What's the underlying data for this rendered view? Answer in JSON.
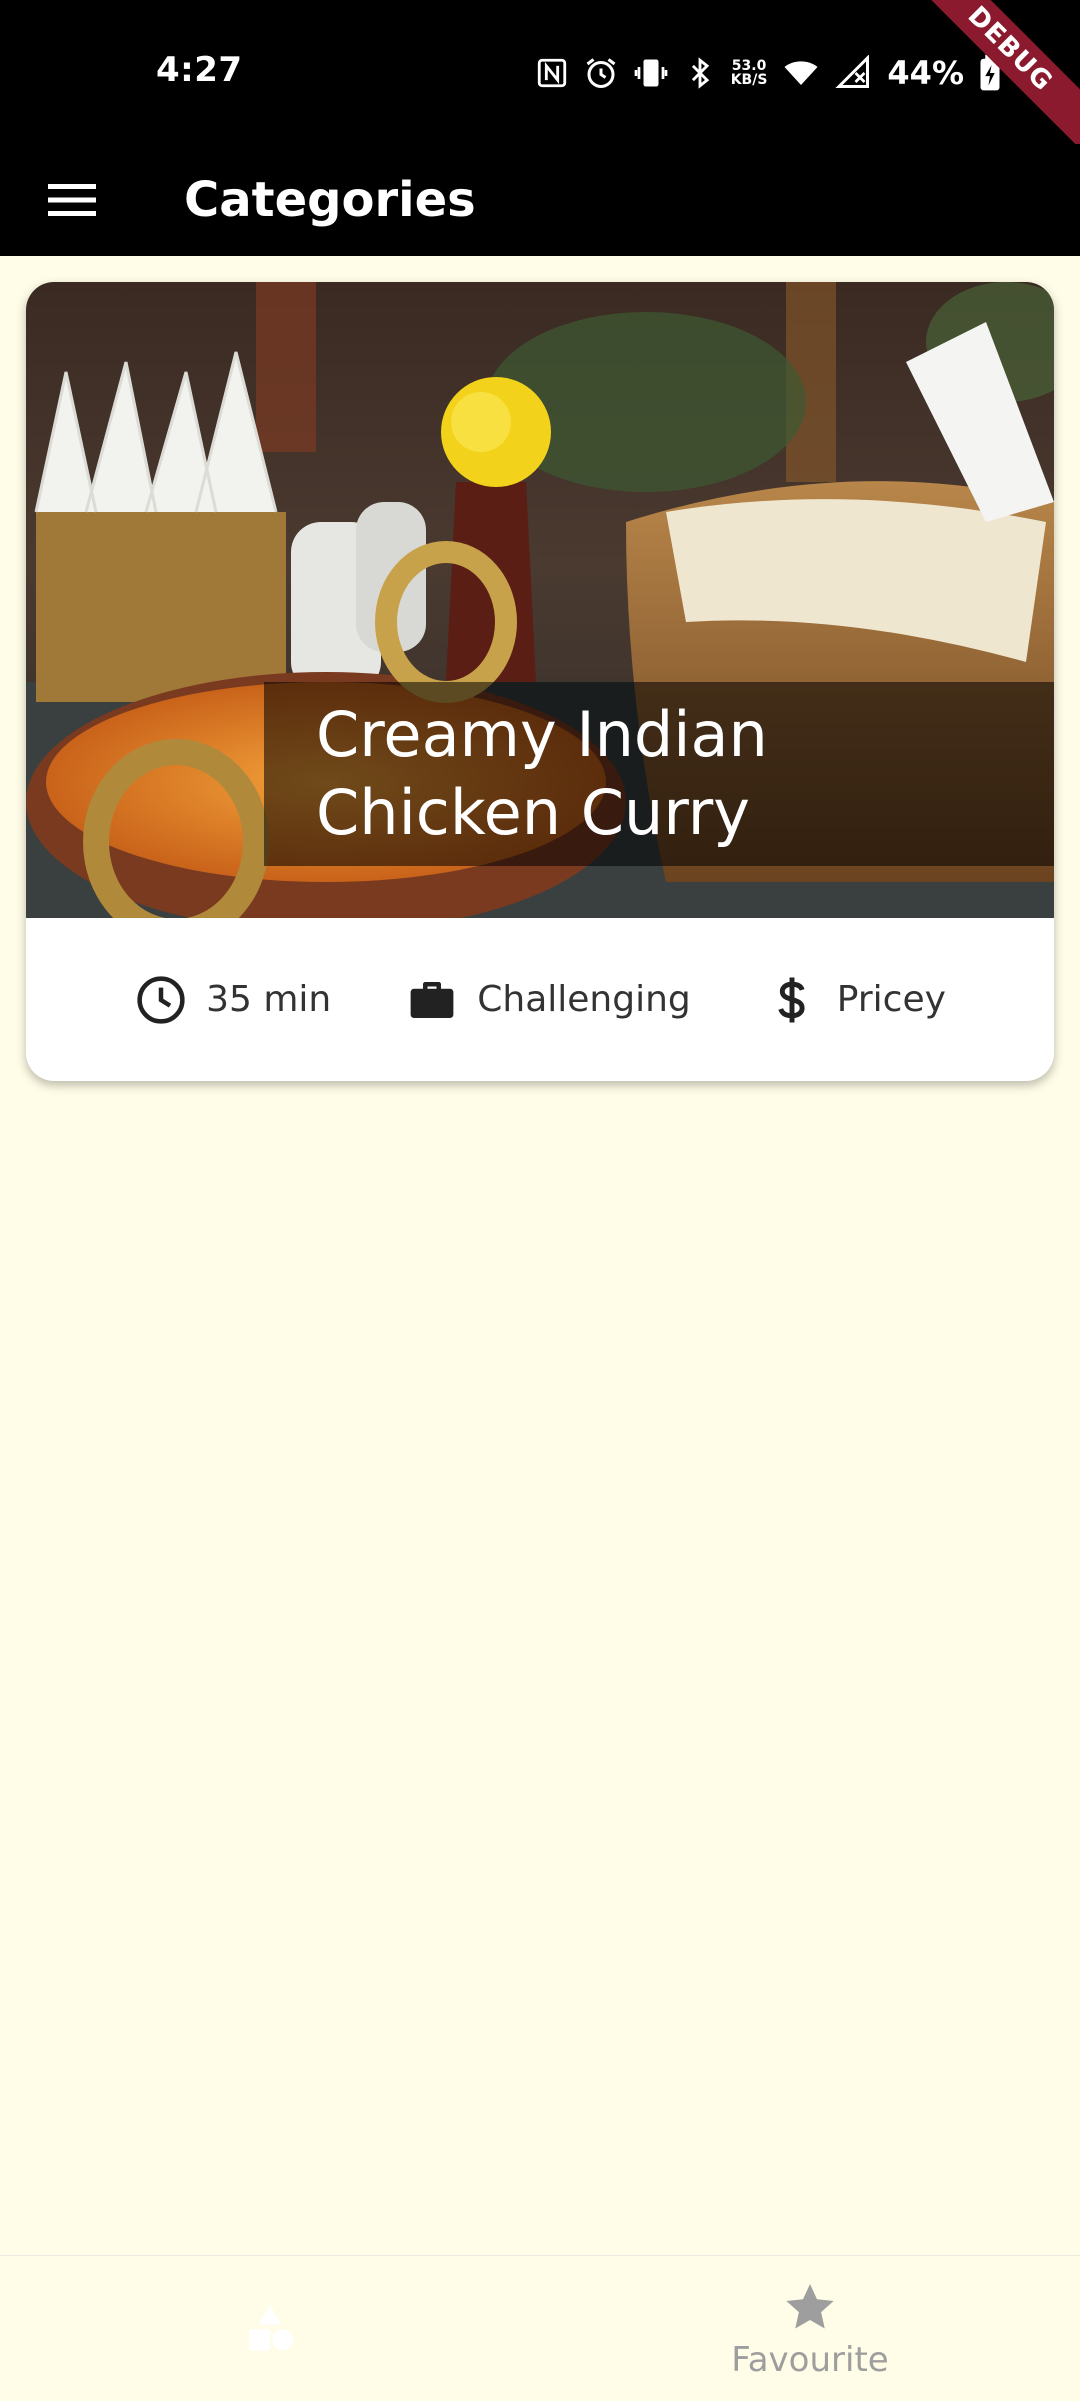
{
  "status_bar": {
    "time": "4:27",
    "network_speed_value": "53.0",
    "network_speed_unit": "KB/S",
    "battery": "44%",
    "icons": [
      "nfc-icon",
      "alarm-icon",
      "vibrate-icon",
      "bluetooth-icon",
      "wifi-icon",
      "signal-icon",
      "battery-charging-icon"
    ]
  },
  "debug_banner": "DEBUG",
  "app_bar": {
    "title": "Categories",
    "menu_icon": "hamburger-menu-icon"
  },
  "meal": {
    "title_line1": "Creamy Indian",
    "title_line2": "Chicken Curry",
    "duration": "35 min",
    "complexity": "Challenging",
    "affordability": "Pricey",
    "duration_icon": "clock-icon",
    "complexity_icon": "briefcase-icon",
    "affordability_icon": "dollar-icon"
  },
  "bottom_nav": {
    "items": [
      {
        "label": "",
        "icon": "category-shapes-icon"
      },
      {
        "label": "Favourite",
        "icon": "star-icon"
      }
    ]
  },
  "colors": {
    "background": "#FFFDE7",
    "app_bar": "#000000",
    "debug_banner": "#8B1A2E",
    "inactive_nav": "#9E9E9E"
  }
}
